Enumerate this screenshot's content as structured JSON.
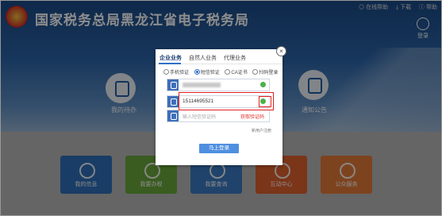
{
  "header": {
    "site_title": "国家税务总局黑龙江省电子税务局",
    "top_links": [
      "◎ 在线帮助",
      "⤓ 下载",
      "ⓘ 帮助"
    ],
    "login_label": "登录"
  },
  "services": {
    "left_label": "我的待办",
    "right_label": "通知公告"
  },
  "tiles": [
    {
      "label": "我的信息",
      "color": "#2f6fba"
    },
    {
      "label": "我要办税",
      "color": "#6aa83b"
    },
    {
      "label": "我要查询",
      "color": "#3b7ac4"
    },
    {
      "label": "互动中心",
      "color": "#e0612f"
    },
    {
      "label": "公众服务",
      "color": "#e47b3a"
    }
  ],
  "modal": {
    "tabs": [
      "企业业务",
      "自然人业务",
      "代理业务"
    ],
    "radios": [
      "手机验证",
      "短信验证",
      "CA证书",
      "扫码登录"
    ],
    "selected_radio": "短信验证",
    "account_value": "",
    "phone_value": "15114695521",
    "code_placeholder": "输入短信验证码",
    "get_code_label": "获取验证码",
    "forgot_label": "新用户注册",
    "submit_label": "马上登录",
    "close_glyph": "×"
  },
  "colors": {
    "accent": "#2f70c8",
    "highlight": "#e02020",
    "success": "#4bb14c"
  }
}
